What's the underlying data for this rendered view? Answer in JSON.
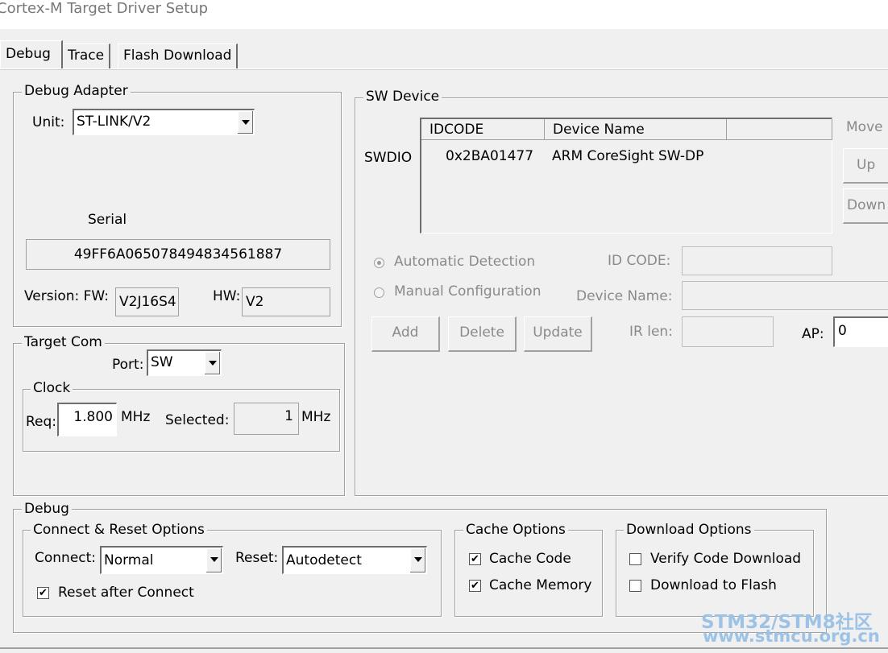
{
  "window": {
    "title": "Cortex-M Target Driver Setup"
  },
  "tabs": [
    {
      "label": "Debug",
      "active": true
    },
    {
      "label": "Trace",
      "active": false
    },
    {
      "label": "Flash Download",
      "active": false
    }
  ],
  "debug_adapter": {
    "legend": "Debug Adapter",
    "unit_label": "Unit:",
    "unit_value": "ST-LINK/V2",
    "serial_label": "Serial",
    "serial_value": "49FF6A065078494834561887",
    "version_label": "Version: FW:",
    "fw_value": "V2J16S4",
    "hw_label": "HW:",
    "hw_value": "V2"
  },
  "target_com": {
    "legend": "Target Com",
    "port_label": "Port:",
    "port_value": "SW",
    "clock_legend": "Clock",
    "req_label": "Req:",
    "req_value": "1.800",
    "req_unit": "MHz",
    "selected_label": "Selected:",
    "selected_value": "1",
    "selected_unit": "MHz"
  },
  "sw_device": {
    "legend": "SW Device",
    "row_label": "SWDIO",
    "columns": [
      "IDCODE",
      "Device Name"
    ],
    "rows": [
      {
        "idcode": "0x2BA01477",
        "device_name": "ARM CoreSight SW-DP"
      }
    ],
    "move_label": "Move",
    "up_label": "Up",
    "down_label": "Down",
    "auto_detect_label": "Automatic Detection",
    "manual_config_label": "Manual Configuration",
    "detection_mode": "automatic",
    "idcode_label": "ID CODE:",
    "idcode_value": "",
    "device_name_label": "Device Name:",
    "device_name_value": "",
    "add_label": "Add",
    "delete_label": "Delete",
    "update_label": "Update",
    "irlen_label": "IR len:",
    "irlen_value": "",
    "ap_label": "AP:",
    "ap_value": "0"
  },
  "debug": {
    "legend": "Debug",
    "connect_reset": {
      "legend": "Connect & Reset Options",
      "connect_label": "Connect:",
      "connect_value": "Normal",
      "reset_label": "Reset:",
      "reset_value": "Autodetect",
      "reset_after_connect_label": "Reset after Connect",
      "reset_after_connect": true
    },
    "cache": {
      "legend": "Cache Options",
      "cache_code_label": "Cache Code",
      "cache_code": true,
      "cache_memory_label": "Cache Memory",
      "cache_memory": true
    },
    "download": {
      "legend": "Download Options",
      "verify_label": "Verify Code Download",
      "verify": false,
      "download_flash_label": "Download to Flash",
      "download_flash": false
    }
  },
  "watermark": {
    "line1": "STM32/STM8社区",
    "line2": "www.stmcu.org.cn"
  },
  "check_mark": "✔"
}
